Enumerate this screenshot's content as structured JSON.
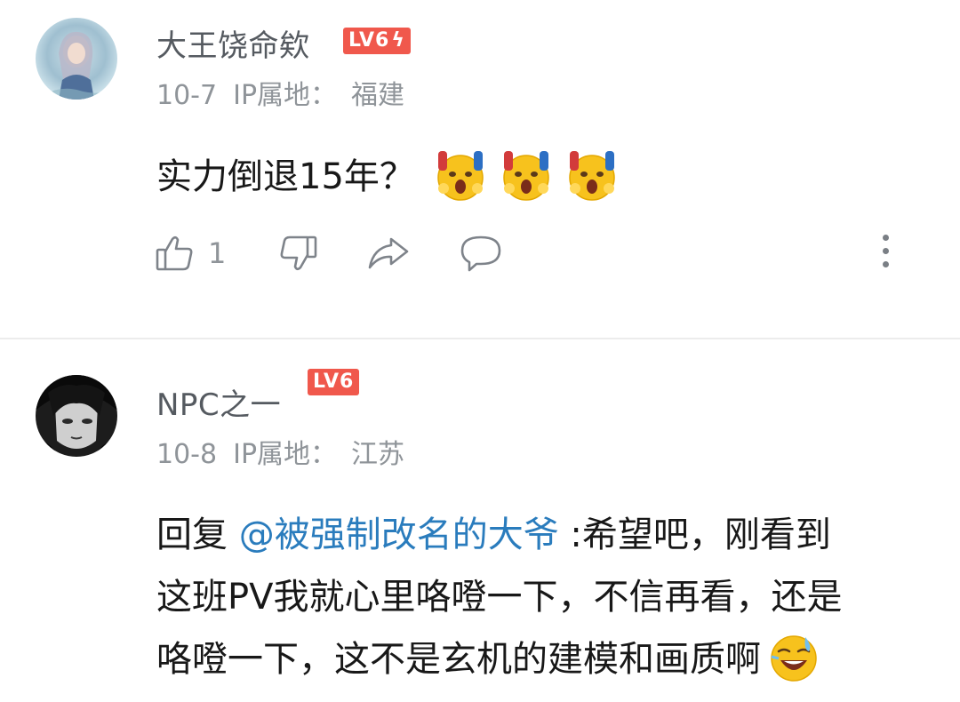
{
  "comments": [
    {
      "username": "大王饶命欸",
      "level": "LV6",
      "date": "10-7",
      "ip_label": "IP属地：",
      "location": "福建",
      "text": "实力倒退15年？",
      "emoji": "shocked-emoji",
      "like_count": "1"
    },
    {
      "username": "NPC之一",
      "level": "LV6",
      "date": "10-8",
      "ip_label": "IP属地：",
      "location": "江苏",
      "reply_prefix": "回复 ",
      "mention": "@被强制改名的大爷",
      "line1": " :希望吧，刚看到",
      "line2": "这班PV我就心里咯噔一下，不信再看，还是",
      "line3": "咯噔一下，这不是玄机的建模和画质啊",
      "emoji": "sweat-laugh-emoji"
    }
  ],
  "colors": {
    "badge": "#f0584c",
    "mention": "#2a7cbd",
    "meta": "#8f9499"
  }
}
